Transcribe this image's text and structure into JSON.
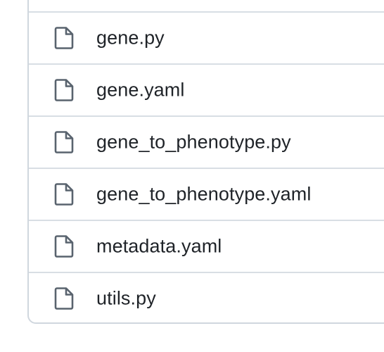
{
  "files": [
    {
      "name": "gene.py",
      "icon": "file-icon"
    },
    {
      "name": "gene.yaml",
      "icon": "file-icon"
    },
    {
      "name": "gene_to_phenotype.py",
      "icon": "file-icon"
    },
    {
      "name": "gene_to_phenotype.yaml",
      "icon": "file-icon"
    },
    {
      "name": "metadata.yaml",
      "icon": "file-icon"
    },
    {
      "name": "utils.py",
      "icon": "file-icon"
    }
  ],
  "colors": {
    "border": "#d0d7de",
    "text": "#1f2328",
    "icon": "#59636e"
  }
}
